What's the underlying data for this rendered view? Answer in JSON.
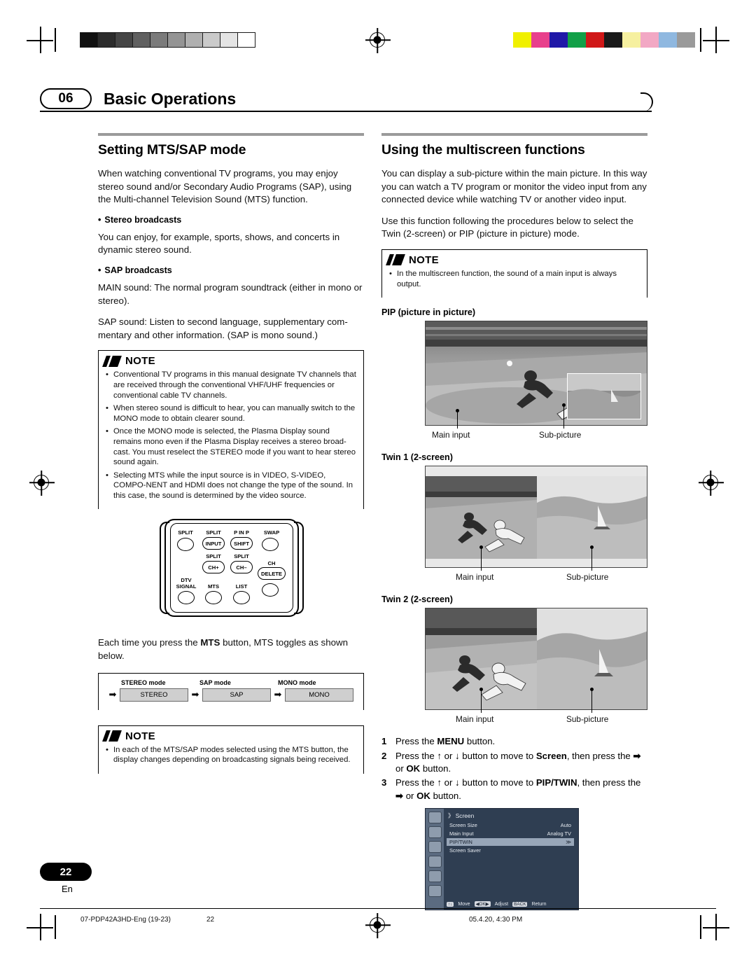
{
  "header": {
    "chapter_number": "06",
    "chapter_title": "Basic Operations"
  },
  "left_column": {
    "section_title": "Setting MTS/SAP mode",
    "intro": "When watching conventional TV programs, you may enjoy stereo sound and/or Secondary Audio Programs (SAP), using the Multi-channel Television Sound (MTS) function.",
    "stereo_head": "Stereo broadcasts",
    "stereo_body": "You can enjoy, for example, sports, shows, and concerts in dynamic stereo sound.",
    "sap_head": "SAP broadcasts",
    "sap_body_1": "MAIN sound: The normal program soundtrack (either in mono or stereo).",
    "sap_body_2": "SAP sound: Listen to second language, supplementary com-mentary and other information. (SAP is mono sound.)",
    "note_title": "NOTE",
    "notes": [
      "Conventional TV programs in this manual designate TV channels that are received through the conventional VHF/UHF frequencies or conventional cable TV channels.",
      "When stereo sound is difficult to hear, you can manually switch to the MONO mode to obtain clearer sound.",
      "Once the MONO mode is selected, the Plasma Display sound remains mono even if the Plasma Display receives a stereo broad-cast. You must reselect the STEREO mode if you want to hear stereo sound again.",
      "Selecting MTS while the input source is in VIDEO, S-VIDEO, COMPO-NENT and HDMI does not change the type of the sound. In this case, the sound is determined by the video source."
    ],
    "remote": {
      "buttons": [
        {
          "label": "SPLIT",
          "sub": ""
        },
        {
          "label": "SPLIT",
          "sub": "INPUT"
        },
        {
          "label": "P IN P",
          "sub": "SHIFT"
        },
        {
          "label": "SWAP",
          "sub": ""
        },
        {
          "label": "SPLIT",
          "sub": "CH+"
        },
        {
          "label": "SPLIT",
          "sub": "CH–"
        },
        {
          "label": "DTV SIGNAL",
          "sub": ""
        },
        {
          "label": "MTS",
          "sub": ""
        },
        {
          "label": "CH LIST",
          "sub": ""
        },
        {
          "label": "CH DELETE",
          "sub": ""
        }
      ],
      "labels": {
        "split1": "SPLIT",
        "split2": "SPLIT",
        "pinp": "P IN P",
        "swap": "SWAP",
        "input": "INPUT",
        "shift": "SHIFT",
        "split3": "SPLIT",
        "split4": "SPLIT",
        "chplus": "CH+",
        "chminus": "CH–",
        "dtv": "DTV",
        "signal": "SIGNAL",
        "mts": "MTS",
        "ch": "CH",
        "list": "LIST",
        "delete": "DELETE"
      }
    },
    "toggle_text_a": "Each time you press the ",
    "toggle_text_b": "MTS",
    "toggle_text_c": " button, MTS toggles as shown below.",
    "chain": {
      "headers": [
        "STEREO mode",
        "SAP mode",
        "MONO mode"
      ],
      "values": [
        "STEREO",
        "SAP",
        "MONO"
      ]
    },
    "note2_title": "NOTE",
    "note2_items": [
      "In each of the MTS/SAP modes selected using the MTS button, the display changes depending on broadcasting signals being received."
    ]
  },
  "right_column": {
    "section_title": "Using the multiscreen functions",
    "intro_1": "You can display a sub-picture within the main picture. In this way you can watch a TV program or monitor the video input from any connected device while watching TV or another video input.",
    "intro_2": "Use this function following the procedures below to select the Twin (2-screen) or PIP (picture in picture) mode.",
    "note_title": "NOTE",
    "notes": [
      "In the multiscreen function, the sound of a main input is always output."
    ],
    "figures": [
      {
        "title": "PIP (picture in picture)",
        "caption_main": "Main input",
        "caption_sub": "Sub-picture"
      },
      {
        "title": "Twin 1 (2-screen)",
        "caption_main": "Main input",
        "caption_sub": "Sub-picture"
      },
      {
        "title": "Twin 2 (2-screen)",
        "caption_main": "Main input",
        "caption_sub": "Sub-picture"
      }
    ],
    "steps": [
      {
        "num": "1",
        "parts": [
          "Press the ",
          "MENU",
          " button."
        ]
      },
      {
        "num": "2",
        "parts": [
          "Press the ",
          "↑",
          " or ",
          "↓",
          " button to move to ",
          "Screen",
          ", then press the ",
          "➡",
          " or ",
          "OK",
          " button."
        ]
      },
      {
        "num": "3",
        "parts": [
          "Press the ",
          "↑",
          " or ",
          "↓",
          " button to move to ",
          "PIP/TWIN",
          ", then press the ",
          "➡",
          " or ",
          "OK",
          " button."
        ]
      }
    ],
    "osd": {
      "title": "Screen",
      "rows": [
        {
          "label": "Screen Size",
          "value": "Auto",
          "selected": false
        },
        {
          "label": "Main Input",
          "value": "Analog TV",
          "selected": false
        },
        {
          "label": "PIP/TWIN",
          "value": "≫",
          "selected": true
        },
        {
          "label": "Screen Saver",
          "value": "",
          "selected": false
        }
      ],
      "footer": [
        {
          "key": "↑↓",
          "text": "Move"
        },
        {
          "key": "◀OK▶",
          "text": "Adjust"
        },
        {
          "key": "BACK",
          "text": "Return"
        }
      ]
    }
  },
  "footer": {
    "page_number": "22",
    "language": "En",
    "left_text": "07-PDP42A3HD-Eng (19-23)",
    "center_text": "22",
    "right_text": "05.4.20, 4:30 PM"
  },
  "color_bars": [
    "#f0f000",
    "#e8408c",
    "#2018a8",
    "#12a048",
    "#d01818",
    "#1a1a1a",
    "#f6f0a0",
    "#f2a8c4",
    "#8fb8e0",
    "#9a9a9a"
  ],
  "gray_bars": [
    "#111111",
    "#2c2c2c",
    "#454545",
    "#606060",
    "#7b7b7b",
    "#949494",
    "#b0b0b0",
    "#cacaca",
    "#e4e4e4",
    "#ffffff"
  ]
}
